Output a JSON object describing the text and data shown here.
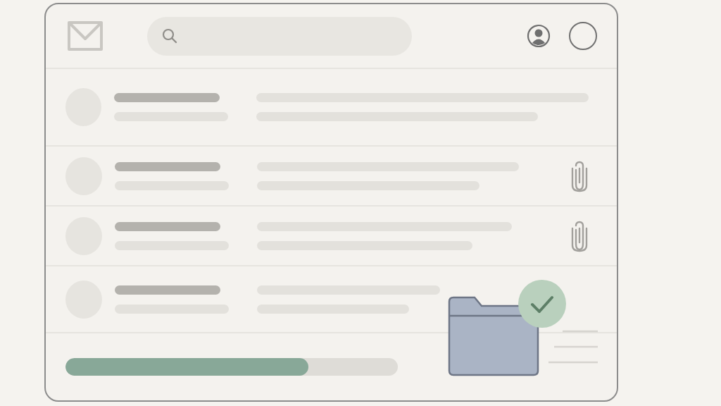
{
  "rows": [
    {
      "attachment": false
    },
    {
      "attachment": true
    },
    {
      "attachment": true
    },
    {
      "attachment": false
    }
  ],
  "progress": {
    "level": 0.73
  },
  "folder": {
    "done": true
  }
}
